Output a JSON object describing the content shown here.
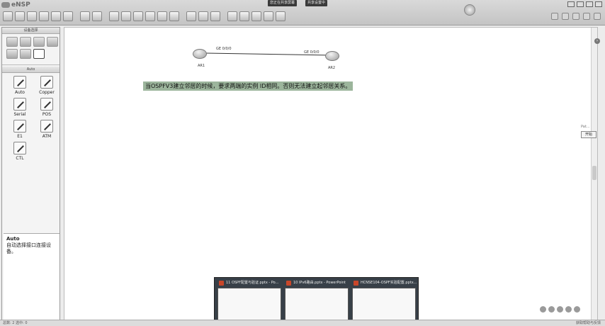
{
  "app": {
    "title": "eNSP",
    "notifications": [
      "您正在共享屏幕",
      "共享设置中"
    ]
  },
  "device_panel": {
    "title": "设备选择",
    "icons": [
      "router-icon",
      "switch-icon",
      "wireless-icon",
      "firewall-icon",
      "pc-icon",
      "cloud-icon",
      "cable-icon"
    ]
  },
  "cable_panel": {
    "title": "Auto",
    "items": [
      {
        "label": "Auto",
        "icon": "auto-cable-icon"
      },
      {
        "label": "Copper",
        "icon": "copper-cable-icon"
      },
      {
        "label": "Serial",
        "icon": "serial-cable-icon"
      },
      {
        "label": "POS",
        "icon": "pos-cable-icon"
      },
      {
        "label": "E1",
        "icon": "e1-cable-icon"
      },
      {
        "label": "ATM",
        "icon": "atm-cable-icon"
      },
      {
        "label": "CTL",
        "icon": "ctl-cable-icon"
      }
    ]
  },
  "description": {
    "title": "Auto",
    "text": "自动选择接口连接设备。"
  },
  "topology": {
    "routers": [
      {
        "name": "AR1",
        "port": "GE 0/0/0"
      },
      {
        "name": "AR2",
        "port": "GE 0/0/0"
      }
    ],
    "note": "当OSPFV3建立邻居的时候，要求两端的实例 ID相同。否则无法建立起邻居关系。"
  },
  "side_panel": {
    "caption": "Pat...",
    "button": "开始"
  },
  "taskbar": {
    "windows": [
      {
        "title": "11 OSPF配置与验证.pptx - Po..."
      },
      {
        "title": "10 IPv6路由.pptx - PowerPoint"
      },
      {
        "title": "HCNSE104-OSPF实验配置.pptx..."
      }
    ]
  },
  "status": {
    "left": "总数: 2  选中: 0",
    "right": "获取帮助与反馈"
  }
}
